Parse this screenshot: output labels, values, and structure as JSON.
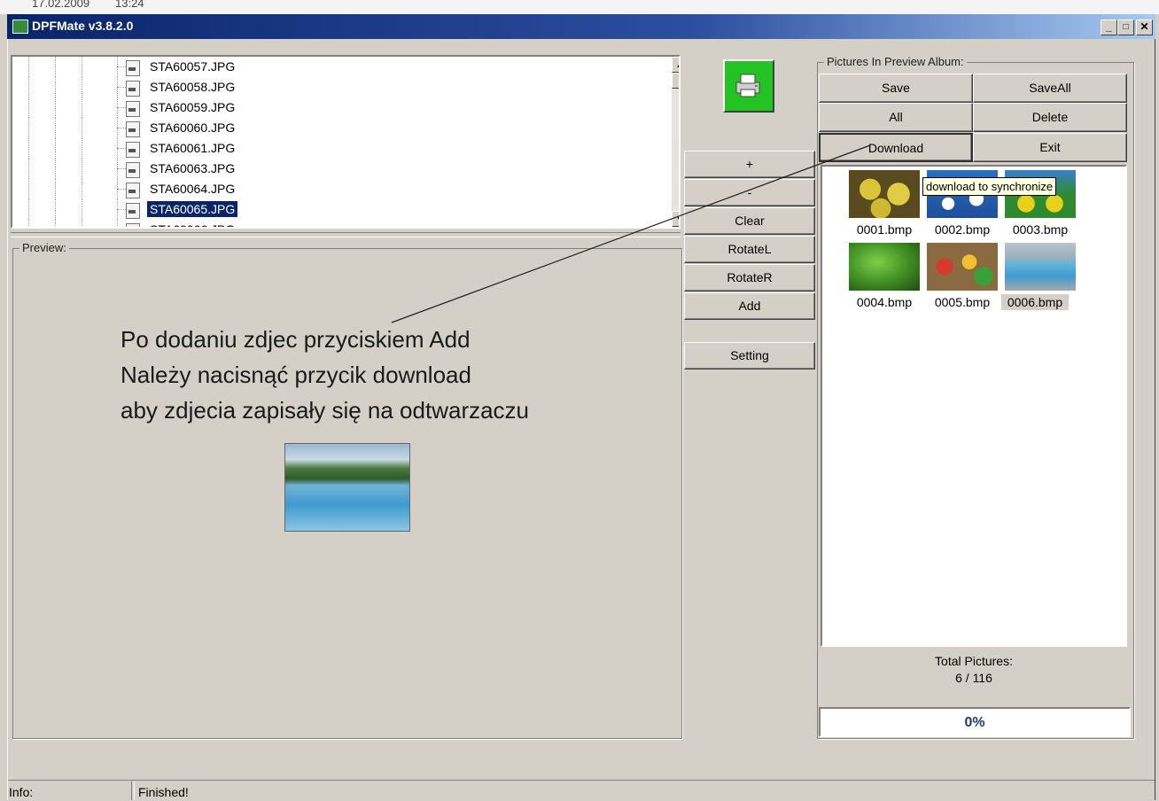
{
  "background_window": {
    "date_text": "17.02.2009",
    "time_text": "13:24"
  },
  "window": {
    "title": "DPFMate v3.8.2.0",
    "minimize": "_",
    "maximize": "□",
    "close": "✕"
  },
  "file_tree": {
    "files": [
      {
        "name": "STA60057.JPG",
        "selected": false
      },
      {
        "name": "STA60058.JPG",
        "selected": false
      },
      {
        "name": "STA60059.JPG",
        "selected": false
      },
      {
        "name": "STA60060.JPG",
        "selected": false
      },
      {
        "name": "STA60061.JPG",
        "selected": false
      },
      {
        "name": "STA60063.JPG",
        "selected": false
      },
      {
        "name": "STA60064.JPG",
        "selected": false
      },
      {
        "name": "STA60065.JPG",
        "selected": true
      },
      {
        "name": "STA60066.JPG",
        "selected": false
      }
    ]
  },
  "preview": {
    "label": "Preview:",
    "annotation_lines": [
      "Po dodaniu zdjec przyciskiem Add",
      "Należy nacisnąć przycik download",
      "aby zdjecia zapisały się na odtwarzaczu"
    ]
  },
  "middle_buttons": {
    "plus": "+",
    "minus": "-",
    "clear": "Clear",
    "rotate_left": "RotateL",
    "rotate_right": "RotateR",
    "add": "Add",
    "setting": "Setting",
    "print_icon": "printer-icon"
  },
  "album": {
    "label": "Pictures In Preview Album:",
    "buttons": {
      "save": "Save",
      "save_all": "SaveAll",
      "all": "All",
      "delete": "Delete",
      "download": "Download",
      "exit": "Exit"
    },
    "tooltip": "download to synchronize",
    "thumbnails": [
      {
        "name": "0001.bmp",
        "selected": false
      },
      {
        "name": "0002.bmp",
        "selected": false
      },
      {
        "name": "0003.bmp",
        "selected": false
      },
      {
        "name": "0004.bmp",
        "selected": false
      },
      {
        "name": "0005.bmp",
        "selected": false
      },
      {
        "name": "0006.bmp",
        "selected": true
      }
    ],
    "total_label": "Total Pictures:",
    "total_value": "6 / 116",
    "progress": "0%"
  },
  "status_bar": {
    "label": "Info:",
    "value": "Finished!"
  },
  "colors": {
    "face": "#d4d0c8",
    "title_start": "#0a246a",
    "title_end": "#a6caf0",
    "selection": "#0a246a",
    "progress_text": "#1f3a78",
    "print_button": "#22c322"
  }
}
